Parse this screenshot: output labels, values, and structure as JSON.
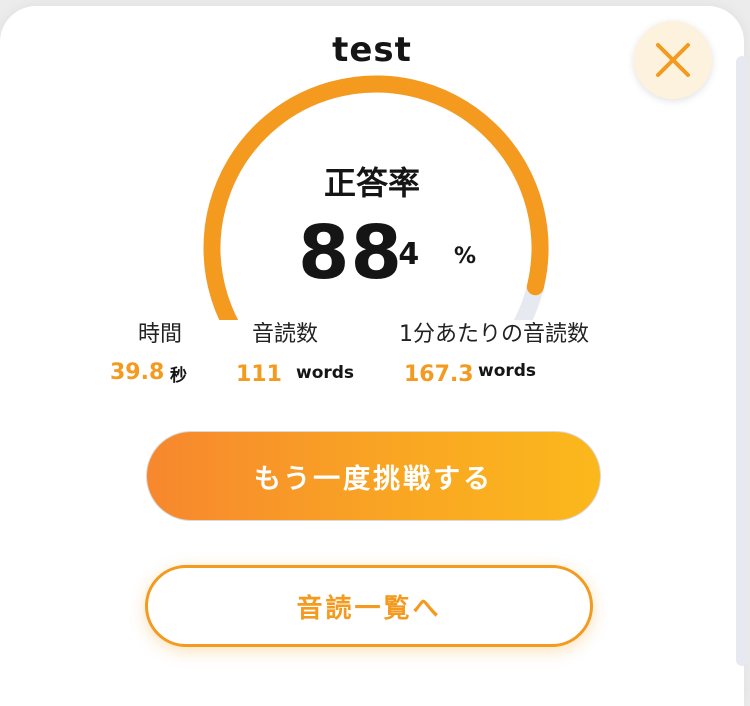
{
  "header": {
    "title": "test"
  },
  "result": {
    "rate_label": "正答率",
    "rate_integer": "88",
    "rate_decimal": ".4",
    "rate_unit": "%",
    "rate_value": 0.884
  },
  "stats": {
    "time": {
      "label": "時間",
      "value": "39.8",
      "unit": "秒"
    },
    "count": {
      "label": "音読数",
      "value": "111",
      "unit": "words"
    },
    "per_minute": {
      "label": "1分あたりの音読数",
      "value": "167.3",
      "unit": "words"
    }
  },
  "actions": {
    "retry_label": "もう一度挑戦する",
    "list_label": "音読一覧へ"
  },
  "icons": {
    "close": "close-icon"
  },
  "colors": {
    "accent": "#f39a1f",
    "gauge_track": "#e6e9ef",
    "close_bg": "#fdf2dd",
    "retry_gradient_start": "#f7872e",
    "retry_gradient_end": "#fbb81c"
  }
}
